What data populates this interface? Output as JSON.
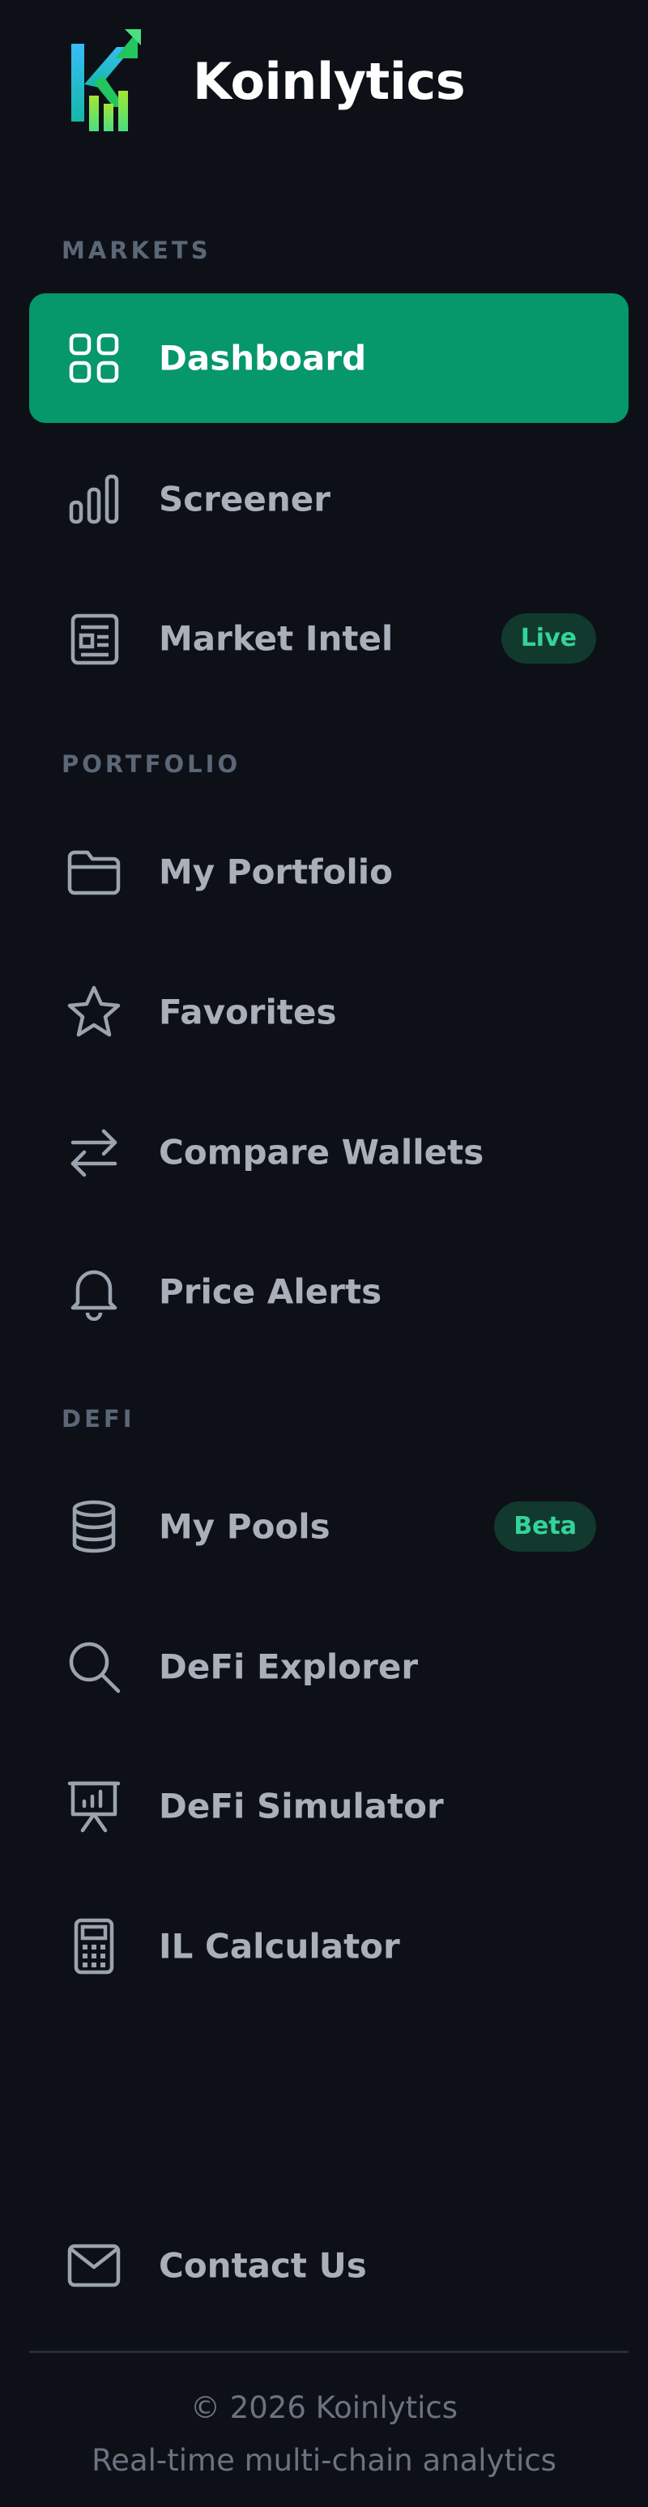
{
  "brand": {
    "name": "Koinlytics",
    "logo_letter": "K"
  },
  "colors": {
    "background": "#0d1117",
    "active": "#06976b",
    "badge_bg": "#11392d",
    "badge_text": "#34d399",
    "section_title": "#5b6676",
    "label": "#a9b0ba"
  },
  "sections": {
    "markets": "MARKETS",
    "portfolio": "PORTFOLIO",
    "defi": "DEFI"
  },
  "nav": {
    "dashboard": {
      "label": "Dashboard",
      "icon": "grid-icon",
      "active": true
    },
    "screener": {
      "label": "Screener",
      "icon": "bar-chart-icon"
    },
    "market_intel": {
      "label": "Market Intel",
      "icon": "newspaper-icon",
      "badge": "Live"
    },
    "my_portfolio": {
      "label": "My Portfolio",
      "icon": "folder-icon"
    },
    "favorites": {
      "label": "Favorites",
      "icon": "star-icon"
    },
    "compare_wallets": {
      "label": "Compare Wallets",
      "icon": "arrows-swap-icon"
    },
    "price_alerts": {
      "label": "Price Alerts",
      "icon": "bell-icon"
    },
    "my_pools": {
      "label": "My Pools",
      "icon": "database-icon",
      "badge": "Beta"
    },
    "defi_explorer": {
      "label": "DeFi Explorer",
      "icon": "search-icon"
    },
    "defi_simulator": {
      "label": "DeFi Simulator",
      "icon": "presentation-icon"
    },
    "il_calculator": {
      "label": "IL Calculator",
      "icon": "calculator-icon"
    },
    "contact_us": {
      "label": "Contact Us",
      "icon": "mail-icon"
    }
  },
  "footer": {
    "copyright": "© 2026 Koinlytics",
    "tagline": "Real-time multi-chain analytics"
  }
}
